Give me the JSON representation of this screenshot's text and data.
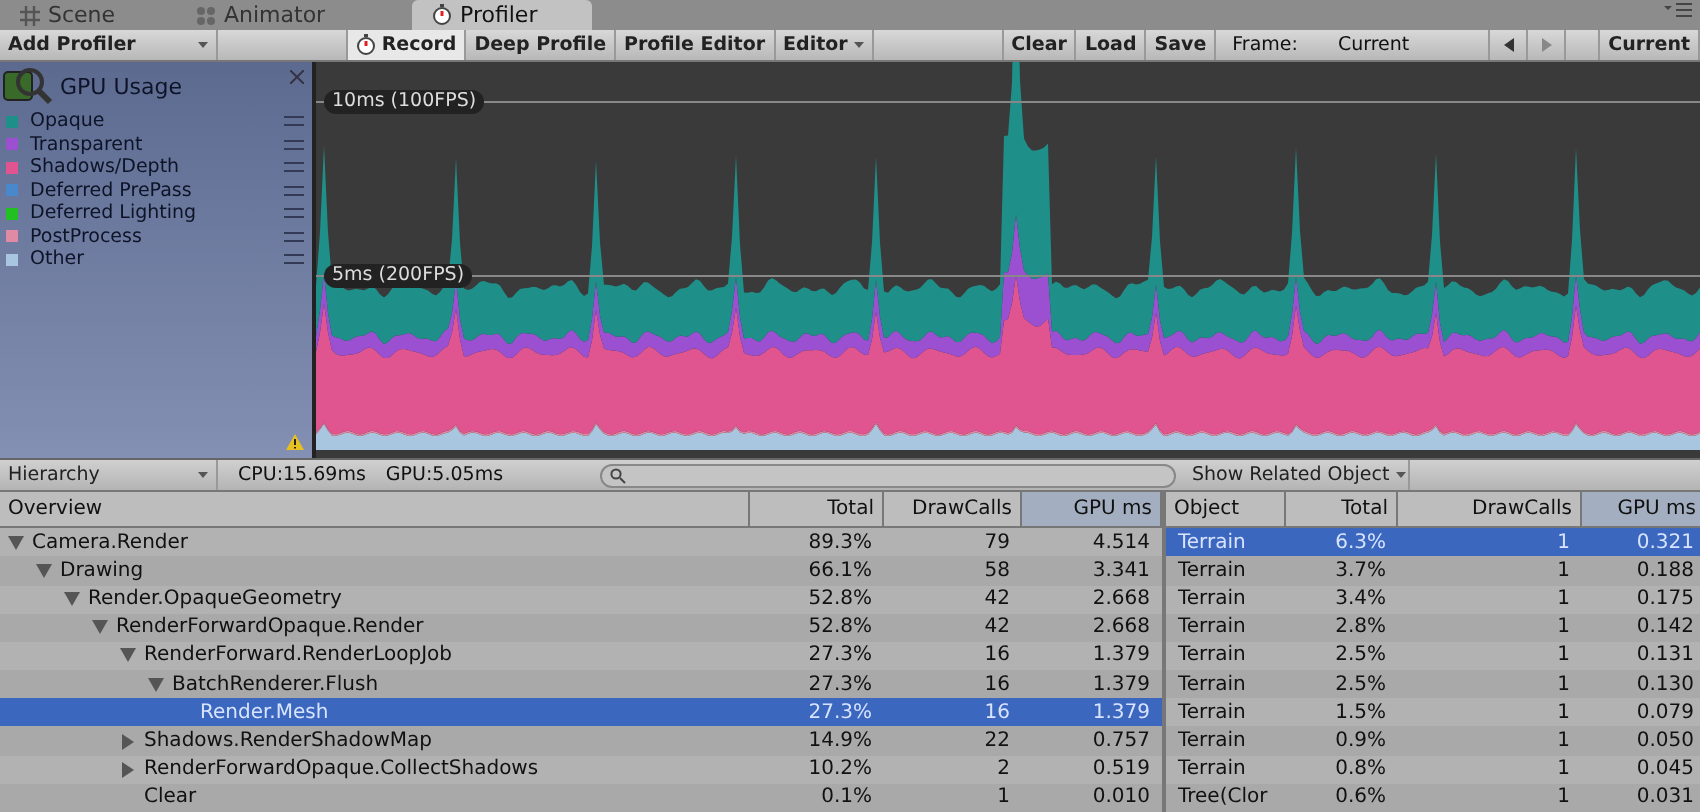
{
  "tabs": [
    {
      "label": "Scene",
      "kind": "scene",
      "selected": false
    },
    {
      "label": "Animator",
      "kind": "animator",
      "selected": false
    },
    {
      "label": "Profiler",
      "kind": "profiler",
      "selected": true
    }
  ],
  "toolbar": {
    "add_profiler": "Add Profiler",
    "buttons": [
      {
        "label": "Record",
        "kind": "record",
        "on": true
      },
      {
        "label": "Deep Profile",
        "kind": "toggle",
        "on": false
      },
      {
        "label": "Profile Editor",
        "kind": "toggle",
        "on": false
      },
      {
        "label": "Editor",
        "kind": "dropdown",
        "on": false
      }
    ],
    "file_buttons": [
      "Clear",
      "Load",
      "Save"
    ],
    "frame_label": "Frame:",
    "frame_value": "Current",
    "current_button": "Current"
  },
  "legend": {
    "title": "GPU Usage",
    "items": [
      {
        "label": "Opaque",
        "color": "#1f8f8a"
      },
      {
        "label": "Transparent",
        "color": "#9a50d0"
      },
      {
        "label": "Shadows/Depth",
        "color": "#e0558f"
      },
      {
        "label": "Deferred PrePass",
        "color": "#4a88cc"
      },
      {
        "label": "Deferred Lighting",
        "color": "#22c022"
      },
      {
        "label": "PostProcess",
        "color": "#e08aa4"
      },
      {
        "label": "Other",
        "color": "#a8c6e0"
      }
    ]
  },
  "chart": {
    "lines": [
      "10ms (100FPS)",
      "5ms (200FPS)"
    ]
  },
  "hierarchy_bar": {
    "view": "Hierarchy",
    "cpu": "CPU:15.69ms",
    "gpu": "GPU:5.05ms",
    "related": "Show Related Object"
  },
  "hierarchy": {
    "columns": [
      {
        "label": "Overview",
        "sorted": false
      },
      {
        "label": "Total",
        "sorted": false
      },
      {
        "label": "DrawCalls",
        "sorted": false
      },
      {
        "label": "GPU ms",
        "sorted": true
      }
    ],
    "rows": [
      {
        "name": "Camera.Render",
        "total": "89.3%",
        "drawcalls": "79",
        "gpu_ms": "4.514",
        "expanded": true,
        "selected": false,
        "children": [
          {
            "name": "Drawing",
            "total": "66.1%",
            "drawcalls": "58",
            "gpu_ms": "3.341",
            "expanded": true,
            "selected": false,
            "children": [
              {
                "name": "Render.OpaqueGeometry",
                "total": "52.8%",
                "drawcalls": "42",
                "gpu_ms": "2.668",
                "expanded": true,
                "selected": false,
                "children": [
                  {
                    "name": "RenderForwardOpaque.Render",
                    "total": "52.8%",
                    "drawcalls": "42",
                    "gpu_ms": "2.668",
                    "expanded": true,
                    "selected": false,
                    "children": [
                      {
                        "name": "RenderForward.RenderLoopJob",
                        "total": "27.3%",
                        "drawcalls": "16",
                        "gpu_ms": "1.379",
                        "expanded": true,
                        "selected": false,
                        "children": [
                          {
                            "name": "BatchRenderer.Flush",
                            "total": "27.3%",
                            "drawcalls": "16",
                            "gpu_ms": "1.379",
                            "expanded": true,
                            "selected": false,
                            "children": [
                              {
                                "name": "Render.Mesh",
                                "total": "27.3%",
                                "drawcalls": "16",
                                "gpu_ms": "1.379",
                                "selected": true
                              }
                            ]
                          }
                        ]
                      },
                      {
                        "name": "Shadows.RenderShadowMap",
                        "total": "14.9%",
                        "drawcalls": "22",
                        "gpu_ms": "0.757",
                        "expanded": false,
                        "selected": false
                      },
                      {
                        "name": "RenderForwardOpaque.CollectShadows",
                        "total": "10.2%",
                        "drawcalls": "2",
                        "gpu_ms": "0.519",
                        "expanded": false,
                        "selected": false
                      },
                      {
                        "name": "Clear",
                        "total": "0.1%",
                        "drawcalls": "1",
                        "gpu_ms": "0.010",
                        "selected": false
                      }
                    ]
                  }
                ]
              }
            ]
          }
        ]
      }
    ]
  },
  "objects": {
    "columns": [
      {
        "label": "Object",
        "sorted": false
      },
      {
        "label": "Total",
        "sorted": false
      },
      {
        "label": "DrawCalls",
        "sorted": false
      },
      {
        "label": "GPU ms",
        "sorted": true
      }
    ],
    "rows": [
      {
        "object": "Terrain",
        "total": "6.3%",
        "drawcalls": "1",
        "gpu_ms": "0.321",
        "selected": true
      },
      {
        "object": "Terrain",
        "total": "3.7%",
        "drawcalls": "1",
        "gpu_ms": "0.188",
        "selected": false
      },
      {
        "object": "Terrain",
        "total": "3.4%",
        "drawcalls": "1",
        "gpu_ms": "0.175",
        "selected": false
      },
      {
        "object": "Terrain",
        "total": "2.8%",
        "drawcalls": "1",
        "gpu_ms": "0.142",
        "selected": false
      },
      {
        "object": "Terrain",
        "total": "2.5%",
        "drawcalls": "1",
        "gpu_ms": "0.131",
        "selected": false
      },
      {
        "object": "Terrain",
        "total": "2.5%",
        "drawcalls": "1",
        "gpu_ms": "0.130",
        "selected": false
      },
      {
        "object": "Terrain",
        "total": "1.5%",
        "drawcalls": "1",
        "gpu_ms": "0.079",
        "selected": false
      },
      {
        "object": "Terrain",
        "total": "0.9%",
        "drawcalls": "1",
        "gpu_ms": "0.050",
        "selected": false
      },
      {
        "object": "Terrain",
        "total": "0.8%",
        "drawcalls": "1",
        "gpu_ms": "0.045",
        "selected": false
      },
      {
        "object": "Tree(Clor",
        "total": "0.6%",
        "drawcalls": "1",
        "gpu_ms": "0.031",
        "selected": false
      }
    ]
  }
}
